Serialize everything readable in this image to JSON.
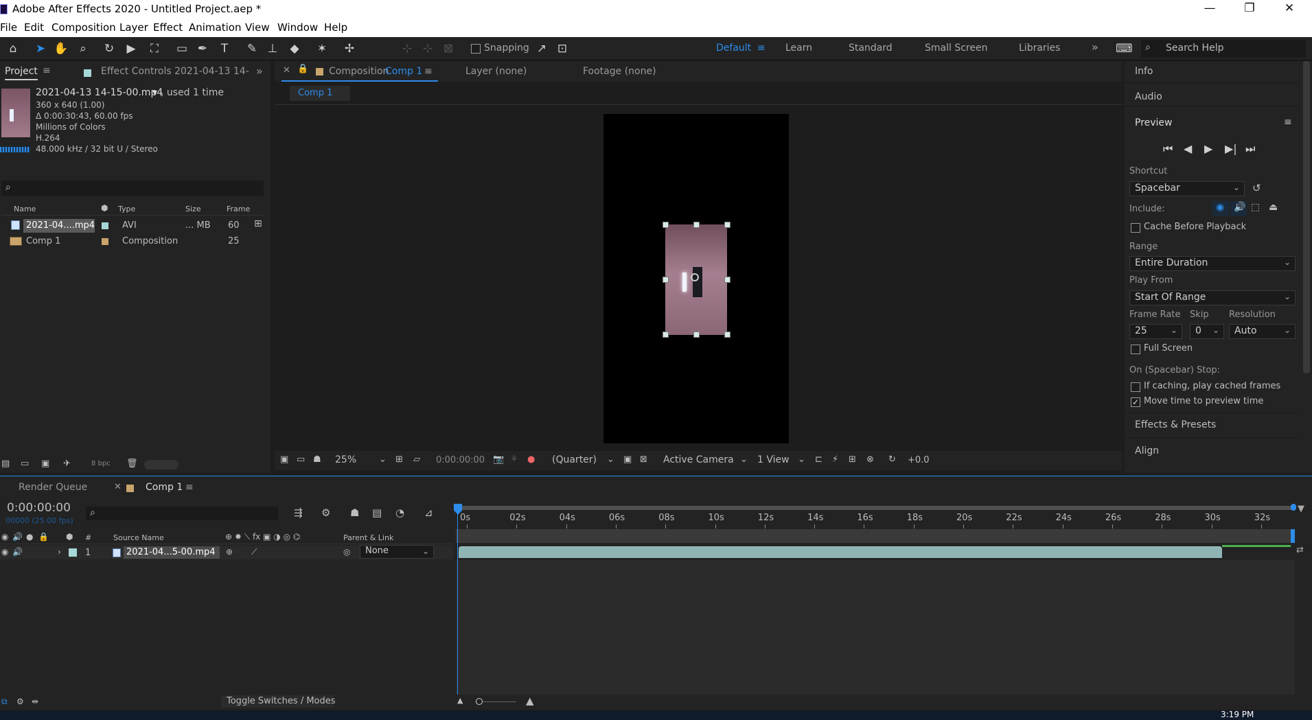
{
  "window": {
    "title": "Adobe After Effects 2020 - Untitled Project.aep *",
    "minimize": "—",
    "maximize": "❐",
    "close": "✕"
  },
  "menu": [
    "File",
    "Edit",
    "Composition",
    "Layer",
    "Effect",
    "Animation",
    "View",
    "Window",
    "Help"
  ],
  "toolbar": {
    "snapping_label": "Snapping",
    "workspaces": [
      "Default",
      "Learn",
      "Standard",
      "Small Screen",
      "Libraries"
    ],
    "active_workspace": "Default",
    "overflow": "»",
    "search_placeholder": "Search Help"
  },
  "project_panel": {
    "tab_project": "Project",
    "tab_effect_controls": "Effect Controls 2021-04-13 14-",
    "footage": {
      "name": "2021-04-13 14-15-00.mp4",
      "used": ", used 1 time",
      "dimensions": "360 x 640 (1.00)",
      "duration": "Δ 0:00:30:43, 60.00 fps",
      "colors": "Millions of Colors",
      "codec": "H.264",
      "audio": "48.000 kHz / 32 bit U / Stereo"
    },
    "search_placeholder": "",
    "columns": [
      "Name",
      "Type",
      "Size",
      "Frame"
    ],
    "items": [
      {
        "name": "2021-04....mp4",
        "type": "AVI",
        "size": "... MB",
        "frame": "60"
      },
      {
        "name": "Comp 1",
        "type": "Composition",
        "size": "",
        "frame": "25"
      }
    ],
    "bpc": "8 bpc"
  },
  "composition_panel": {
    "tab_label": "Composition",
    "tab_comp": "Comp 1",
    "tab_layer": "Layer  (none)",
    "tab_footage": "Footage  (none)",
    "breadcrumb": "Comp 1",
    "zoom": "25%",
    "timecode": "0:00:00:00",
    "resolution": "(Quarter)",
    "camera": "Active Camera",
    "views": "1 View",
    "exposure": "+0.0"
  },
  "right_panel": {
    "info": "Info",
    "audio": "Audio",
    "preview": "Preview",
    "shortcut_label": "Shortcut",
    "shortcut_value": "Spacebar",
    "include_label": "Include:",
    "cache_before_playback": "Cache Before Playback",
    "range_label": "Range",
    "range_value": "Entire Duration",
    "play_from_label": "Play From",
    "play_from_value": "Start Of Range",
    "frame_rate_label": "Frame Rate",
    "frame_rate_value": "25",
    "skip_label": "Skip",
    "skip_value": "0",
    "resolution_label": "Resolution",
    "resolution_value": "Auto",
    "full_screen": "Full Screen",
    "stop_label": "On (Spacebar) Stop:",
    "if_caching": "If caching, play cached frames",
    "move_time": "Move time to preview time",
    "move_time_checked": true,
    "effects_presets": "Effects & Presets",
    "align": "Align"
  },
  "timeline": {
    "tab_render_queue": "Render Queue",
    "tab_comp": "Comp 1",
    "timecode": "0:00:00:00",
    "frames": "00000 (25.00 fps)",
    "columns": {
      "num": "#",
      "source": "Source Name",
      "parent": "Parent & Link"
    },
    "layer": {
      "index": "1",
      "name": "2021-04...5-00.mp4",
      "parent": "None"
    },
    "ticks": [
      "0s",
      "02s",
      "04s",
      "06s",
      "08s",
      "10s",
      "12s",
      "14s",
      "16s",
      "18s",
      "20s",
      "22s",
      "24s",
      "26s",
      "28s",
      "30s",
      "32s"
    ],
    "footer": "Toggle Switches / Modes"
  },
  "taskbar": {
    "time": "3:19 PM"
  },
  "colors": {
    "accent": "#2d8ceb",
    "panel": "#232323",
    "bg": "#1d1d1d",
    "layer_bar": "#8fb4b4"
  }
}
